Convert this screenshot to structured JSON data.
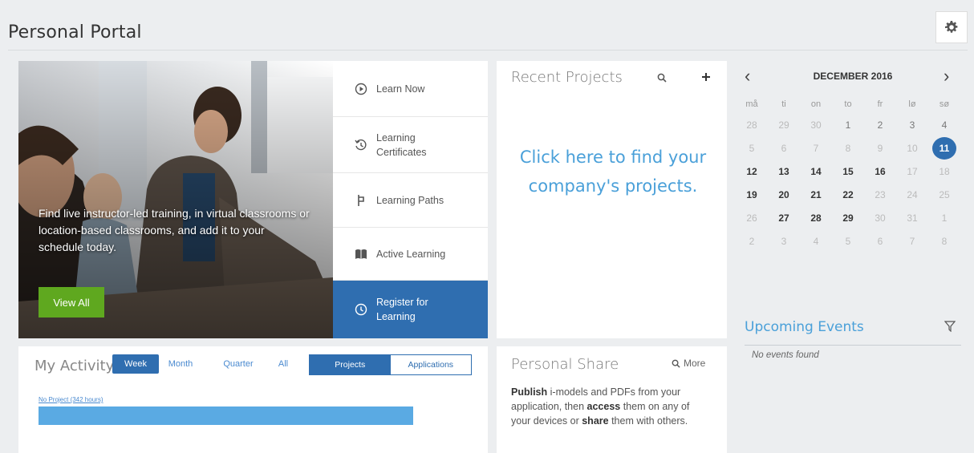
{
  "header": {
    "title": "Personal Portal",
    "settings_icon": "gear-icon"
  },
  "hero": {
    "text": "Find live instructor-led training, in virtual classrooms or location-based classrooms, and add it to your schedule today.",
    "button": "View All"
  },
  "menu": {
    "items": [
      {
        "label": "Learn Now",
        "icon": "play-circle-icon"
      },
      {
        "label": "Learning Certificates",
        "icon": "history-icon"
      },
      {
        "label": "Learning Paths",
        "icon": "path-icon"
      },
      {
        "label": "Active Learning",
        "icon": "book-icon"
      },
      {
        "label": "Register for Learning",
        "icon": "clock-icon",
        "active": true
      }
    ]
  },
  "recent_projects": {
    "title": "Recent Projects",
    "link": "Click here to find your company's projects."
  },
  "calendar": {
    "month": "DECEMBER 2016",
    "weekdays": [
      "må",
      "ti",
      "on",
      "to",
      "fr",
      "lø",
      "sø"
    ],
    "weeks": [
      [
        "28",
        "29",
        "30",
        "1",
        "2",
        "3",
        "4"
      ],
      [
        "5",
        "6",
        "7",
        "8",
        "9",
        "10",
        "11"
      ],
      [
        "12",
        "13",
        "14",
        "15",
        "16",
        "17",
        "18"
      ],
      [
        "19",
        "20",
        "21",
        "22",
        "23",
        "24",
        "25"
      ],
      [
        "26",
        "27",
        "28",
        "29",
        "30",
        "31",
        "1"
      ],
      [
        "2",
        "3",
        "4",
        "5",
        "6",
        "7",
        "8"
      ]
    ],
    "today": "11"
  },
  "upcoming": {
    "title": "Upcoming Events",
    "empty": "No events found"
  },
  "activity": {
    "title": "My Activity",
    "periods": [
      "Week",
      "Month",
      "Quarter",
      "All"
    ],
    "selected_period": "Week",
    "toggle": [
      "Projects",
      "Applications"
    ],
    "selected_toggle": "Projects",
    "bar_label": "No Project (342 hours)"
  },
  "share": {
    "title": "Personal Share",
    "more": "More",
    "text_publish": "Publish",
    "text_1": " i-models and PDFs from your application, then ",
    "text_access": "access",
    "text_2": " them on any of your devices or ",
    "text_share": "share",
    "text_3": " them with others."
  },
  "colors": {
    "accent": "#2f6eb0",
    "link": "#4aa0d9",
    "green": "#5fa81f",
    "bar": "#5aaae3"
  }
}
